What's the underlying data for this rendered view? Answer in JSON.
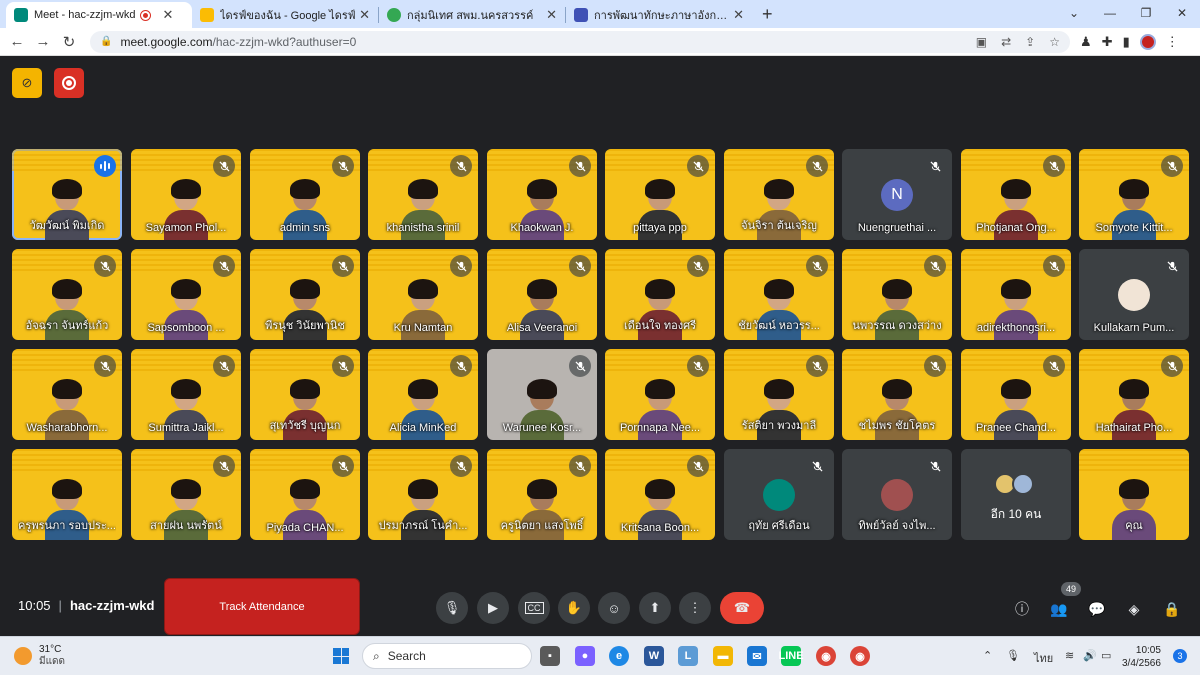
{
  "browser": {
    "tabs": [
      {
        "title": "Meet - hac-zzjm-wkd",
        "fav_color": "#00897b",
        "active": true
      },
      {
        "title": "ไดรฟ์ของฉัน - Google ไดรฟ์",
        "fav_color": "#fbbc04",
        "active": false
      },
      {
        "title": "กลุ่มนิเทศ สพม.นครสวรรค์",
        "fav_color": "#34a853",
        "active": false
      },
      {
        "title": "การพัฒนาทักษะภาษาอังกฤษ English",
        "fav_color": "#3f51b5",
        "active": false
      }
    ],
    "new_tab": "+",
    "url_host": "meet.google.com",
    "url_path": "/hac-zzjm-wkd?authuser=0"
  },
  "grid": {
    "tiles": [
      {
        "name": "วัฒวัฒน์ พิมเกิด",
        "style": "yellow",
        "speaking": true
      },
      {
        "name": "Sayamon Phol...",
        "style": "yellow"
      },
      {
        "name": "admin sns",
        "style": "yellow"
      },
      {
        "name": "khanistha srinil",
        "style": "yellow"
      },
      {
        "name": "Khaokwan J.",
        "style": "yellow"
      },
      {
        "name": "pittaya ppp",
        "style": "yellow"
      },
      {
        "name": "จันจิรา ต้นเจริญ",
        "style": "yellow"
      },
      {
        "name": "Nuengruethai ...",
        "style": "dark",
        "avatar": "N",
        "avatar_color": "#5c6bc0"
      },
      {
        "name": "Photjanat Ong...",
        "style": "yellow"
      },
      {
        "name": "Somyote Kittit...",
        "style": "yellow"
      },
      {
        "name": "อัจฉรา จันทร์แก้ว",
        "style": "yellow"
      },
      {
        "name": "Sapsomboon ...",
        "style": "yellow"
      },
      {
        "name": "พีรนุช วินัยพานิช",
        "style": "yellow"
      },
      {
        "name": "Kru Namtan",
        "style": "yellow"
      },
      {
        "name": "Alisa Veeranoi",
        "style": "yellow"
      },
      {
        "name": "เดือนใจ ทองศรี",
        "style": "yellow"
      },
      {
        "name": "ชัยวัฒน์ หอวรร...",
        "style": "yellow"
      },
      {
        "name": "นพวรรณ ดวงสว่าง",
        "style": "yellow"
      },
      {
        "name": "adirekthongsri...",
        "style": "yellow"
      },
      {
        "name": "Kullakarn Pum...",
        "style": "dark",
        "avatar": "",
        "avatar_color": "#f1e4d6"
      },
      {
        "name": "Washarabhorn...",
        "style": "yellow"
      },
      {
        "name": "Sumittra Jaikl...",
        "style": "yellow"
      },
      {
        "name": "สุเทวัชรี บุญนก",
        "style": "yellow"
      },
      {
        "name": "Alicia MinKed",
        "style": "yellow"
      },
      {
        "name": "Warunee Kosr...",
        "style": "photo"
      },
      {
        "name": "Pornnapa Nee...",
        "style": "yellow"
      },
      {
        "name": "รัสติยา พวงมาลี",
        "style": "yellow"
      },
      {
        "name": "ชไมพร ชัยโคตร",
        "style": "yellow"
      },
      {
        "name": "Pranee Chand...",
        "style": "yellow"
      },
      {
        "name": "Hathairat Pho...",
        "style": "yellow"
      },
      {
        "name": "ครูพรนภา รอบประ...",
        "style": "yellow",
        "nomute": true
      },
      {
        "name": "สายฝน นพรัตน์",
        "style": "yellow"
      },
      {
        "name": "Piyada CHAN...",
        "style": "yellow"
      },
      {
        "name": "ปรมาภรณ์ โนคำ...",
        "style": "yellow"
      },
      {
        "name": "ครูนิตยา แสงโพธิ์",
        "style": "yellow"
      },
      {
        "name": "Kritsana Boon...",
        "style": "yellow"
      },
      {
        "name": "ฤทัย ศรีเดือน",
        "style": "dark",
        "avatar": "",
        "avatar_color": "#00897b"
      },
      {
        "name": "ทิพย์วัลย์ จงไพ...",
        "style": "dark",
        "avatar": "",
        "avatar_color": "#a05050"
      },
      {
        "name": "อีก 10 คน",
        "style": "more"
      },
      {
        "name": "คุณ",
        "style": "yellow",
        "nomute": true
      }
    ]
  },
  "bottom": {
    "time": "10:05",
    "meeting_code": "hac-zzjm-wkd",
    "track_attendance": "Track Attendance",
    "participants_count": "49"
  },
  "taskbar": {
    "temperature": "31°C",
    "condition": "มีแดด",
    "search": "Search",
    "language": "ไทย",
    "time": "10:05",
    "date": "3/4/2566",
    "notifications": "3"
  },
  "colors": {
    "meet_bg": "#202124",
    "tile_yellow": "#f5c11a",
    "end_call": "#ea4335",
    "track_button": "#c5221f"
  }
}
